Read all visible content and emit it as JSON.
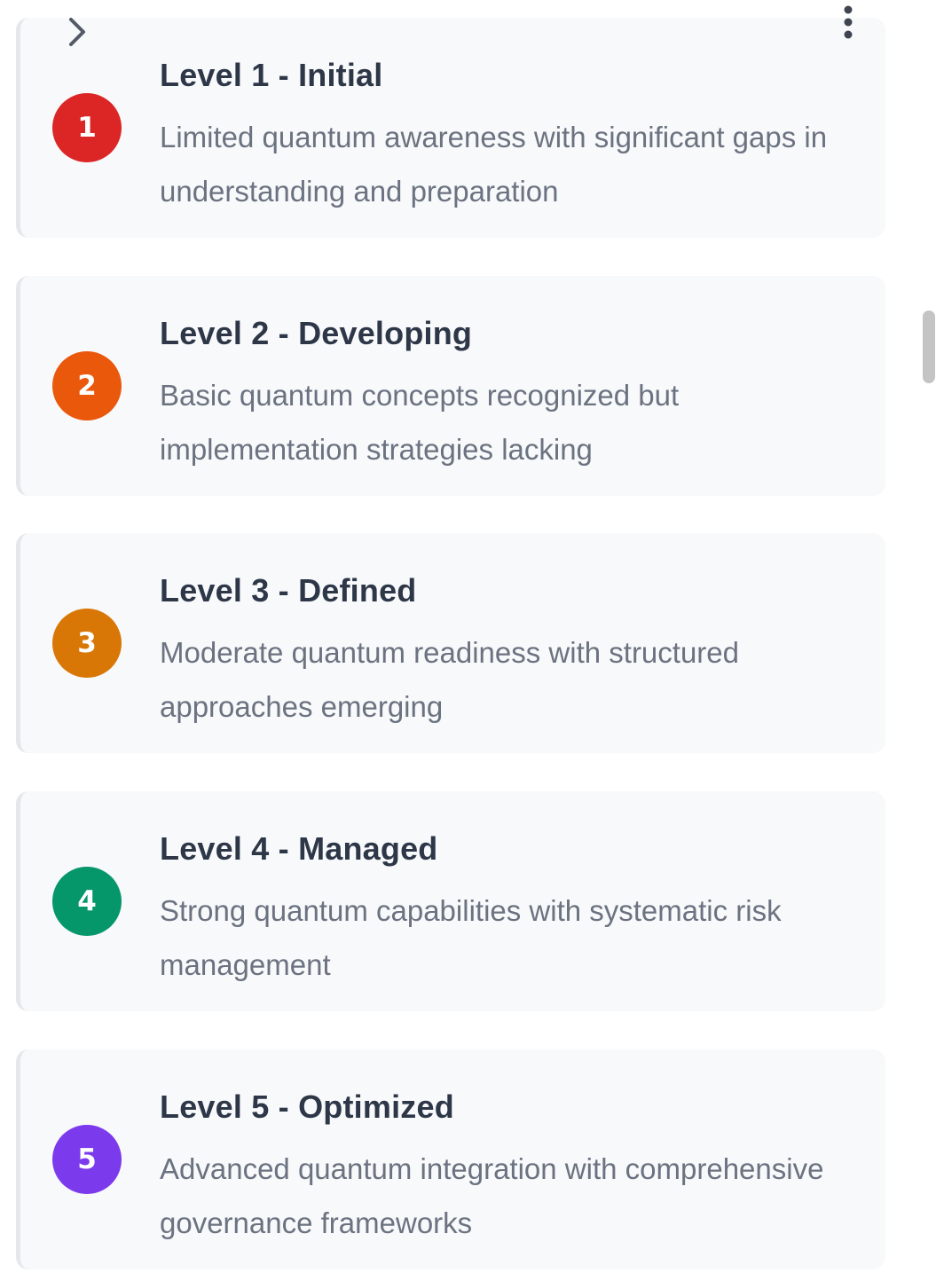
{
  "icons": {
    "back": "chevron-right-icon",
    "menu": "more-vertical-icon"
  },
  "levels": [
    {
      "number": "1",
      "title": "Level 1 - Initial",
      "description": "Limited quantum awareness with significant gaps in understanding and preparation",
      "color": "#dc2626"
    },
    {
      "number": "2",
      "title": "Level 2 - Developing",
      "description": "Basic quantum concepts recognized but implementation strategies lacking",
      "color": "#ea580c"
    },
    {
      "number": "3",
      "title": "Level 3 - Defined",
      "description": "Moderate quantum readiness with structured approaches emerging",
      "color": "#d97706"
    },
    {
      "number": "4",
      "title": "Level 4 - Managed",
      "description": "Strong quantum capabilities with systematic risk management",
      "color": "#059669"
    },
    {
      "number": "5",
      "title": "Level 5 - Optimized",
      "description": "Advanced quantum integration with comprehensive governance frameworks",
      "color": "#7c3aed"
    }
  ]
}
